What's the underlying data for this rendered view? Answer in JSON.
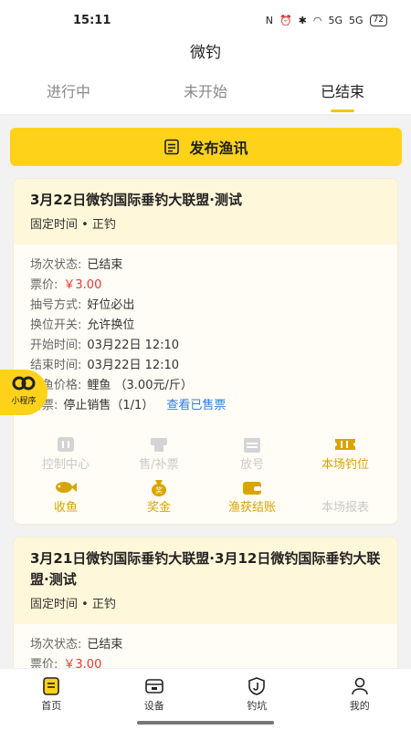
{
  "status": {
    "time": "15:11",
    "signal1": "5G",
    "signal2": "5G",
    "battery": "72"
  },
  "title": "微钓",
  "tabs": [
    {
      "label": "进行中"
    },
    {
      "label": "未开始"
    },
    {
      "label": "已结束"
    }
  ],
  "publish_label": "发布渔讯",
  "cards": [
    {
      "title": "3月22日微钓国际垂钓大联盟·测试",
      "subtitle": "固定时间 • 正钓",
      "rows": [
        {
          "label": "场次状态:",
          "value": "已结束"
        },
        {
          "label": "票价:",
          "value": "￥3.00"
        },
        {
          "label": "抽号方式:",
          "value": "好位必出"
        },
        {
          "label": "换位开关:",
          "value": "允许换位"
        },
        {
          "label": "开始时间:",
          "value": "03月22日 12:10"
        },
        {
          "label": "结束时间:",
          "value": "03月22日 12:10"
        },
        {
          "label": "回鱼价格:",
          "value": "鲤鱼 （3.00元/斤）"
        },
        {
          "label": "售票:",
          "value": "停止销售（1/1）",
          "link": "查看已售票"
        }
      ],
      "actions": [
        {
          "label": "控制中心"
        },
        {
          "label": "售/补票"
        },
        {
          "label": "放号"
        },
        {
          "label": "本场钓位"
        },
        {
          "label": "收鱼"
        },
        {
          "label": "奖金"
        },
        {
          "label": "渔获结账"
        },
        {
          "label": "本场报表"
        }
      ]
    },
    {
      "title": "3月21日微钓国际垂钓大联盟·3月12日微钓国际垂钓大联盟·测试",
      "subtitle": "固定时间 • 正钓",
      "rows": [
        {
          "label": "场次状态:",
          "value": "已结束"
        },
        {
          "label": "票价:",
          "value": "￥3.00"
        }
      ]
    }
  ],
  "mini_program_label": "小程序",
  "bottom_nav": [
    {
      "label": "首页"
    },
    {
      "label": "设备"
    },
    {
      "label": "钓坑"
    },
    {
      "label": "我的"
    }
  ],
  "colors": {
    "accent": "#ffd21a",
    "price": "#e53935",
    "link": "#2f7de1"
  }
}
